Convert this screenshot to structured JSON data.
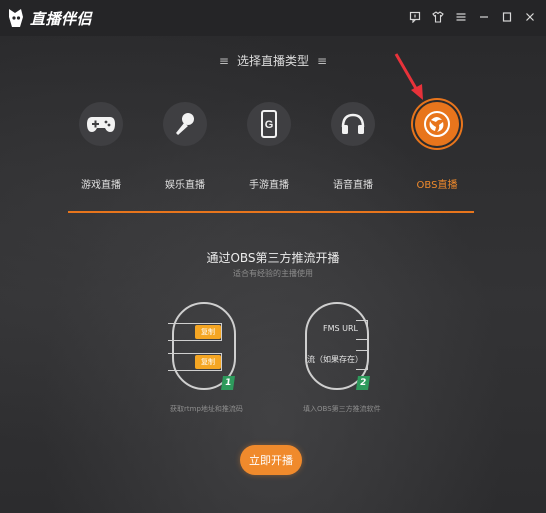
{
  "app": {
    "title": "直播伴侣"
  },
  "window_controls": [
    {
      "name": "feedback-icon"
    },
    {
      "name": "skin-icon"
    },
    {
      "name": "menu-icon"
    },
    {
      "name": "minimize-icon"
    },
    {
      "name": "maximize-icon"
    },
    {
      "name": "close-icon"
    }
  ],
  "section": {
    "title": "选择直播类型",
    "deco": "≡"
  },
  "modes": [
    {
      "label": "游戏直播",
      "icon": "gamepad-icon",
      "active": false
    },
    {
      "label": "娱乐直播",
      "icon": "microphone-icon",
      "active": false
    },
    {
      "label": "手游直播",
      "icon": "phone-icon",
      "active": false
    },
    {
      "label": "语音直播",
      "icon": "headphones-icon",
      "active": false
    },
    {
      "label": "OBS直播",
      "icon": "obs-icon",
      "active": true
    }
  ],
  "obs": {
    "title": "通过OBS第三方推流开播",
    "subtitle": "适合有经验的主播使用",
    "step1": {
      "copy1": "复制",
      "copy2": "复制",
      "number": "1",
      "caption": "获取rtmp地址和推流码"
    },
    "step2": {
      "field1": "FMS URL",
      "field2": "流（如果存在）",
      "number": "2",
      "caption": "填入OBS第三方推流软件"
    }
  },
  "start_button": {
    "label": "立即开播"
  },
  "colors": {
    "accent": "#e8751c",
    "button": "#f08a2c",
    "badge": "#2e9a5c",
    "annotation_arrow": "#e8323a"
  }
}
